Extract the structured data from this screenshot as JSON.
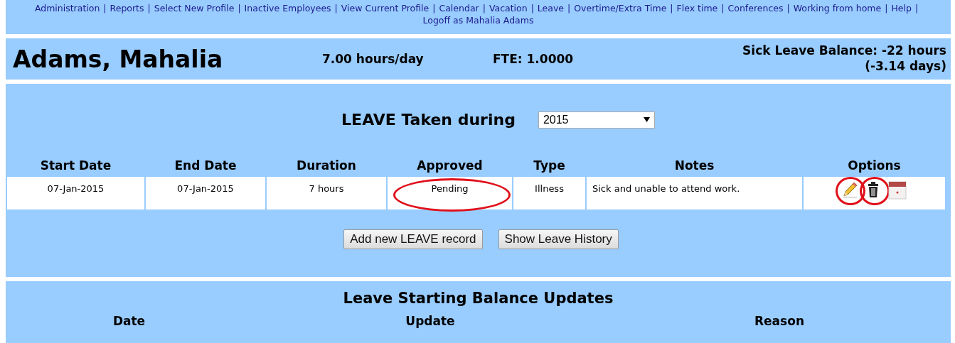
{
  "nav": {
    "links": [
      "Administration",
      "Reports",
      "Select New Profile",
      "Inactive Employees",
      "View Current Profile",
      "Calendar",
      "Vacation",
      "Leave",
      "Overtime/Extra Time",
      "Flex time",
      "Conferences",
      "Working from home",
      "Help",
      "Logoff as Mahalia Adams"
    ],
    "separator": "|"
  },
  "header": {
    "name": "Adams, Mahalia",
    "hours": "7.00 hours/day",
    "fte": "FTE: 1.0000",
    "balance": "Sick Leave Balance: -22 hours",
    "balance_days": "(-3.14 days)"
  },
  "leave": {
    "title": "LEAVE Taken during",
    "year": "2015",
    "columns": [
      "Start Date",
      "End Date",
      "Duration",
      "Approved",
      "Type",
      "Notes",
      "Options"
    ],
    "rows": [
      {
        "start": "07-Jan-2015",
        "end": "07-Jan-2015",
        "duration": "7 hours",
        "approved": "Pending",
        "approved_circled": true,
        "type": "Illness",
        "notes": "Sick and unable to attend work.",
        "options": [
          {
            "kind": "edit",
            "circled": true
          },
          {
            "kind": "delete",
            "circled": true
          },
          {
            "kind": "calendar",
            "circled": false
          }
        ]
      }
    ],
    "buttons": [
      "Add new LEAVE record",
      "Show Leave History"
    ]
  },
  "balance_updates": {
    "title": "Leave Starting Balance Updates",
    "columns": [
      "Date",
      "Update",
      "Reason"
    ]
  }
}
